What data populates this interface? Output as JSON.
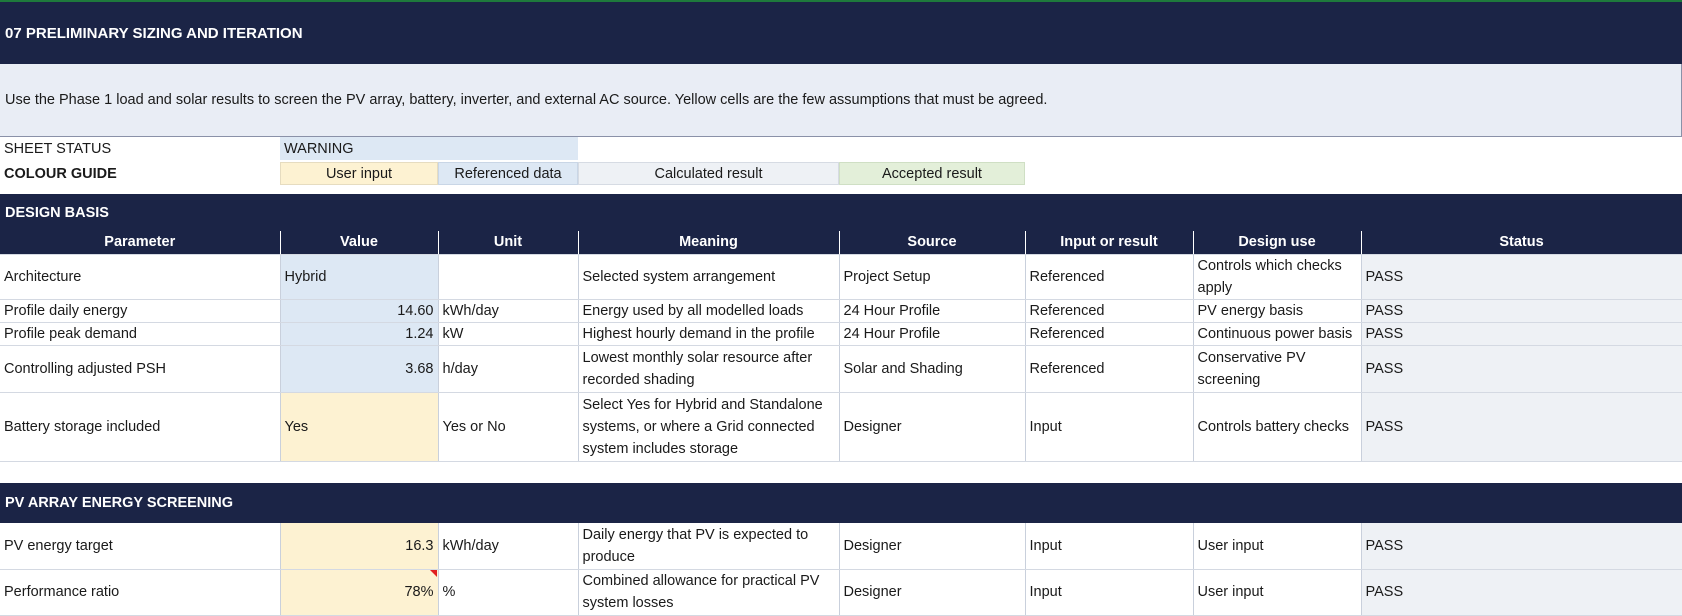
{
  "title": "07  PRELIMINARY SIZING AND ITERATION",
  "intro": "Use the Phase 1 load and solar results to screen the PV array, battery, inverter, and external AC source. Yellow cells are the few assumptions that must be agreed.",
  "sheet_status": {
    "label": "SHEET STATUS",
    "value": "WARNING"
  },
  "colour_guide": {
    "label": "COLOUR GUIDE",
    "user_input": "User input",
    "referenced": "Referenced data",
    "calculated": "Calculated result",
    "accepted": "Accepted result"
  },
  "sections": {
    "design_basis": "DESIGN BASIS",
    "pv_array": "PV ARRAY ENERGY SCREENING"
  },
  "columns": [
    "Parameter",
    "Value",
    "Unit",
    "Meaning",
    "Source",
    "Input or result",
    "Design use",
    "Status"
  ],
  "design_basis_rows": [
    {
      "param": "Architecture",
      "value": "Hybrid",
      "unit": "",
      "meaning": "Selected system arrangement",
      "source": "Project Setup",
      "io": "Referenced",
      "use": "Controls which checks apply",
      "status": "PASS"
    },
    {
      "param": "Profile daily energy",
      "value": "14.60",
      "unit": "kWh/day",
      "meaning": "Energy used by all modelled loads",
      "source": "24 Hour Profile",
      "io": "Referenced",
      "use": "PV energy basis",
      "status": "PASS"
    },
    {
      "param": "Profile peak demand",
      "value": "1.24",
      "unit": "kW",
      "meaning": "Highest hourly demand in the profile",
      "source": "24 Hour Profile",
      "io": "Referenced",
      "use": "Continuous power basis",
      "status": "PASS"
    },
    {
      "param": "Controlling adjusted PSH",
      "value": "3.68",
      "unit": "h/day",
      "meaning": "Lowest monthly solar resource after recorded shading",
      "source": "Solar and Shading",
      "io": "Referenced",
      "use": "Conservative PV screening",
      "status": "PASS"
    },
    {
      "param": "Battery storage included",
      "value": "Yes",
      "unit": "Yes or No",
      "meaning": "Select Yes for Hybrid and Standalone systems, or where a Grid connected system includes storage",
      "source": "Designer",
      "io": "Input",
      "use": "Controls battery checks",
      "status": "PASS"
    }
  ],
  "pv_rows": [
    {
      "param": "PV energy target",
      "value": "16.3",
      "unit": "kWh/day",
      "meaning": "Daily energy that PV is expected to produce",
      "source": "Designer",
      "io": "Input",
      "use": "User input",
      "status": "PASS"
    },
    {
      "param": "Performance ratio",
      "value": "78%",
      "unit": "%",
      "meaning": "Combined allowance for practical PV system losses",
      "source": "Designer",
      "io": "Input",
      "use": "User input",
      "status": "PASS"
    }
  ]
}
